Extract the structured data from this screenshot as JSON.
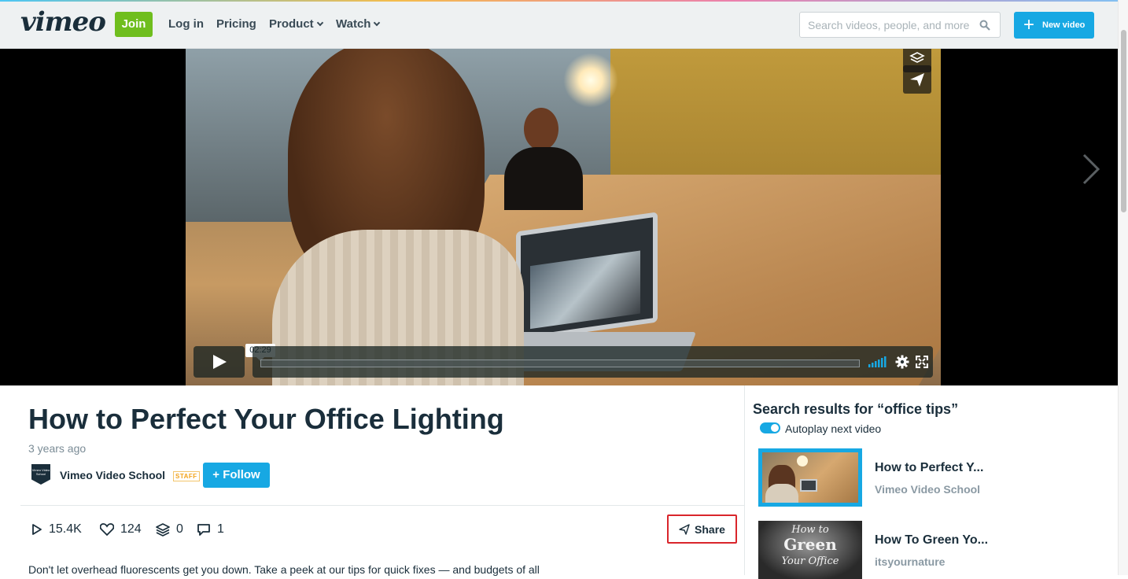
{
  "header": {
    "logo": "vimeo",
    "join_label": "Join",
    "nav": [
      "Log in",
      "Pricing",
      "Product",
      "Watch"
    ],
    "search_placeholder": "Search videos, people, and more",
    "new_video_label": "New video"
  },
  "player": {
    "time_badge": "02:29",
    "progress": 0
  },
  "video": {
    "title": "How to Perfect Your Office Lighting",
    "age": "3 years ago",
    "channel": "Vimeo Video School",
    "avatar_text": "Vimeo Video School",
    "staff_badge": "STAFF",
    "follow_label": "Follow",
    "stats": {
      "plays": "15.4K",
      "likes": "124",
      "collections": "0",
      "comments": "1"
    },
    "share_label": "Share",
    "description": "Don't let overhead fluorescents get you down. Take a peek at our tips for quick fixes — and budgets of all"
  },
  "sidebar": {
    "title": "Search results for “office tips”",
    "autoplay_label": "Autoplay next video",
    "autoplay_on": true,
    "videos": [
      {
        "title": "How to Perfect Y...",
        "channel": "Vimeo Video School",
        "thumb_text": ""
      },
      {
        "title": "How To Green Yo...",
        "channel": "itsyournature",
        "thumb_text": [
          "How to",
          "Green",
          "Your Office"
        ]
      }
    ]
  },
  "colors": {
    "accent": "#17a8e3",
    "join": "#6fbe1e",
    "text": "#1a2e3b",
    "share_outline": "#d9252b"
  }
}
